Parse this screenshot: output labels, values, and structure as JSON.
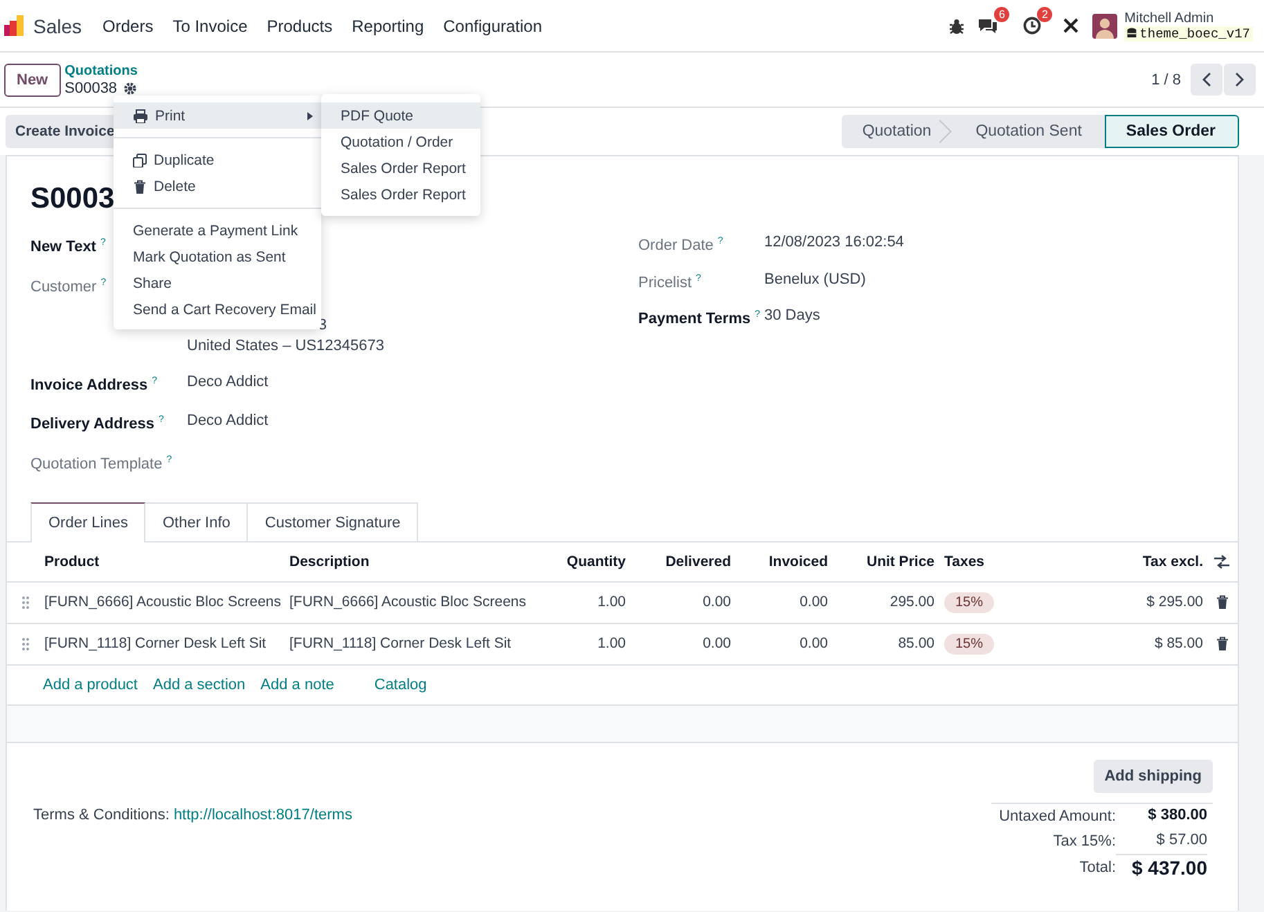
{
  "navbar": {
    "app_name": "Sales",
    "menu": [
      "Orders",
      "To Invoice",
      "Products",
      "Reporting",
      "Configuration"
    ],
    "messages_badge": "6",
    "activities_badge": "2",
    "user_name": "Mitchell Admin",
    "database": "theme_boec_v17"
  },
  "control_panel": {
    "new_button": "New",
    "breadcrumb_parent": "Quotations",
    "record_name": "S00038",
    "pager": "1 / 8"
  },
  "create_invoice_button": "Create Invoice",
  "stages": [
    {
      "label": "Quotation",
      "selected": false
    },
    {
      "label": "Quotation Sent",
      "selected": false
    },
    {
      "label": "Sales Order",
      "selected": true
    }
  ],
  "action_menu": {
    "print": {
      "label": "Print",
      "selected": true
    },
    "record_actions": [
      "Duplicate",
      "Delete"
    ],
    "more_actions": [
      "Generate a Payment Link",
      "Mark Quotation as Sent",
      "Share",
      "Send a Cart Recovery Email"
    ]
  },
  "print_submenu": [
    {
      "label": "PDF Quote",
      "selected": true
    },
    {
      "label": "Quotation / Order",
      "selected": false
    },
    {
      "label": "Sales Order Report",
      "selected": false
    },
    {
      "label": "Sales Order Report",
      "selected": false
    }
  ],
  "form": {
    "title": "S0003",
    "left_fields": [
      {
        "label": "New Text",
        "help": "?",
        "required": true
      },
      {
        "label": "Customer",
        "help": "?",
        "required": false,
        "value_lines": [
          {
            "text": "3",
            "clipped": true
          },
          {
            "text": "United States – US12345673",
            "clipped": false
          }
        ]
      },
      {
        "label": "Invoice Address",
        "help": "?",
        "required": true,
        "value": "Deco Addict"
      },
      {
        "label": "Delivery Address",
        "help": "?",
        "required": true,
        "value": "Deco Addict"
      },
      {
        "label": "Quotation Template",
        "help": "?",
        "required": false
      }
    ],
    "right_fields": [
      {
        "label": "Order Date",
        "help": "?",
        "required": false,
        "value": "12/08/2023 16:02:54"
      },
      {
        "label": "Pricelist",
        "help": "?",
        "required": false,
        "value": "Benelux (USD)"
      },
      {
        "label": "Payment Terms",
        "help": "?",
        "required": true,
        "value": "30 Days"
      }
    ]
  },
  "tabs": [
    {
      "label": "Order Lines",
      "selected": true
    },
    {
      "label": "Other Info",
      "selected": false
    },
    {
      "label": "Customer Signature",
      "selected": false
    }
  ],
  "order_lines": {
    "columns": [
      "Product",
      "Description",
      "Quantity",
      "Delivered",
      "Invoiced",
      "Unit Price",
      "Taxes",
      "Tax excl."
    ],
    "rows": [
      {
        "product": "[FURN_6666] Acoustic Bloc Screens",
        "description": "[FURN_6666] Acoustic Bloc Screens",
        "quantity": "1.00",
        "delivered": "0.00",
        "invoiced": "0.00",
        "unit_price": "295.00",
        "taxes": "15%",
        "subtotal": "$ 295.00"
      },
      {
        "product": "[FURN_1118] Corner Desk Left Sit",
        "description": "[FURN_1118] Corner Desk Left Sit",
        "quantity": "1.00",
        "delivered": "0.00",
        "invoiced": "0.00",
        "unit_price": "85.00",
        "taxes": "15%",
        "subtotal": "$ 85.00"
      }
    ],
    "add_links": [
      "Add a product",
      "Add a section",
      "Add a note",
      "Catalog"
    ]
  },
  "add_shipping_button": "Add shipping",
  "terms": {
    "label": "Terms & Conditions:",
    "link": "http://localhost:8017/terms"
  },
  "totals": [
    {
      "kind": "subtotal",
      "label": "Untaxed Amount:",
      "value": "$ 380.00"
    },
    {
      "kind": "tax",
      "label": "Tax 15%:",
      "value": "$ 57.00"
    },
    {
      "kind": "total",
      "label": "Total:",
      "value": "$ 437.00"
    }
  ]
}
